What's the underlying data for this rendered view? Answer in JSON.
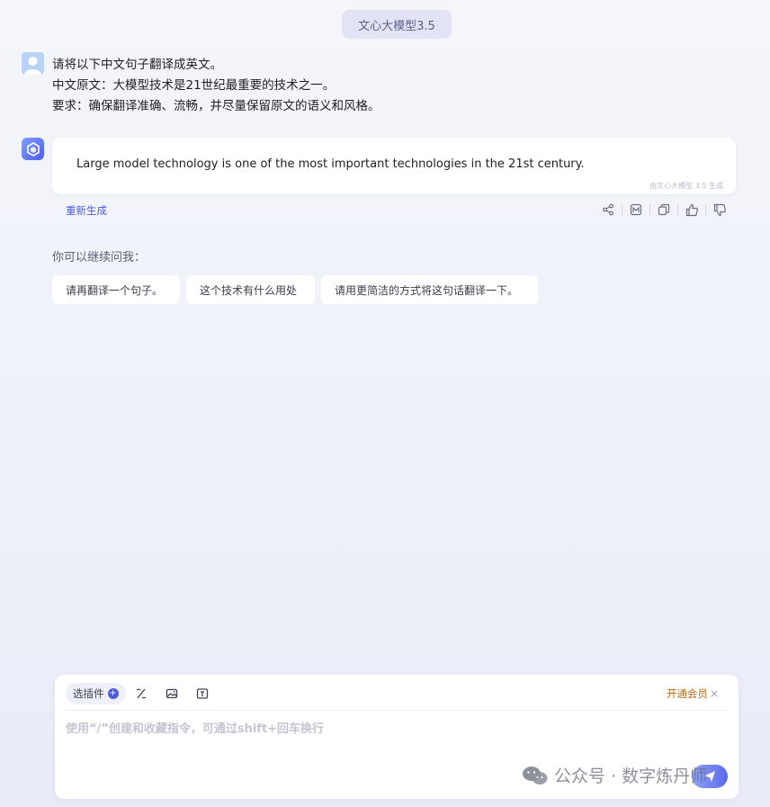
{
  "header": {
    "model_label": "文心大模型3.5"
  },
  "user_message": {
    "lines": [
      "请将以下中文句子翻译成英文。",
      "中文原文：大模型技术是21世纪最重要的技术之一。",
      "要求：确保翻译准确、流畅，并尽量保留原文的语义和风格。"
    ]
  },
  "bot_message": {
    "text": "Large model technology is one of the most important technologies in the 21st century.",
    "credit": "由文心大模型 3.5 生成",
    "regenerate_label": "重新生成",
    "actions": [
      "share-icon",
      "mindmap-icon",
      "copy-icon",
      "thumbs-up-icon",
      "thumbs-down-icon"
    ]
  },
  "followups": {
    "title": "你可以继续问我：",
    "items": [
      "请再翻译一个句子。",
      "这个技术有什么用处",
      "请用更简洁的方式将这句话翻译一下。"
    ]
  },
  "composer": {
    "plugin_label": "选插件",
    "tools": [
      "instruction-icon",
      "image-icon",
      "document-icon"
    ],
    "vip_label": "开通会员",
    "placeholder": "使用“/”创建和收藏指令，可通过shift+回车换行"
  },
  "watermark": {
    "text": "公众号 · 数字炼丹师"
  },
  "colors": {
    "accent": "#4e5bd9",
    "vip": "#b76a13",
    "background": "#eef0f9"
  }
}
